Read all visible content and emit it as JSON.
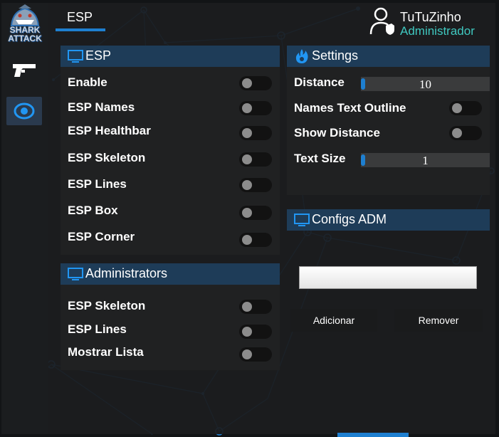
{
  "sidebar": {
    "logo_text": "SHARK ATTACK",
    "items": [
      {
        "icon": "pistol-icon"
      },
      {
        "icon": "eye-icon",
        "active": true
      }
    ]
  },
  "header": {
    "tab_label": "ESP",
    "user_name": "TuTuZinho",
    "user_role": "Administrador"
  },
  "esp_panel": {
    "title": "ESP",
    "rows": [
      {
        "label": "Enable",
        "on": false
      },
      {
        "label": "ESP Names",
        "on": false
      },
      {
        "label": "ESP Healthbar",
        "on": false
      },
      {
        "label": "ESP Skeleton",
        "on": false
      },
      {
        "label": "ESP Lines",
        "on": false
      },
      {
        "label": "ESP Box",
        "on": false
      },
      {
        "label": "ESP Corner",
        "on": false
      }
    ]
  },
  "admin_panel": {
    "title": "Administrators",
    "rows": [
      {
        "label": "ESP Skeleton",
        "on": false
      },
      {
        "label": "ESP Lines",
        "on": false
      },
      {
        "label": "Mostrar Lista",
        "on": false
      }
    ]
  },
  "settings_panel": {
    "title": "Settings",
    "distance_label": "Distance",
    "distance_value": "10",
    "names_outline_label": "Names Text Outline",
    "show_distance_label": "Show Distance",
    "text_size_label": "Text Size",
    "text_size_value": "1"
  },
  "configs_panel": {
    "title": "Configs ADM",
    "input_value": "",
    "add_label": "Adicionar",
    "remove_label": "Remover"
  },
  "colors": {
    "accent": "#1e7fd0",
    "role": "#3fc8c0",
    "panel_header": "#1e3c58"
  }
}
